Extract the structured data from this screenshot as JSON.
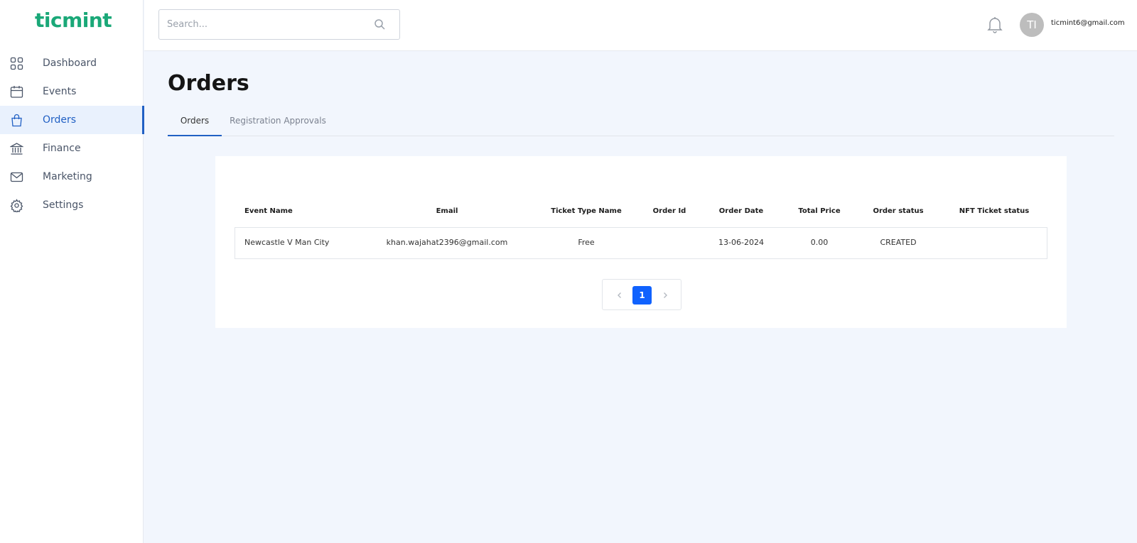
{
  "app": {
    "logo_text": "ticmint",
    "brand_color": "#1aa878",
    "accent_color": "#2160c4"
  },
  "sidebar": {
    "items": [
      {
        "label": "Dashboard",
        "icon": "grid-icon",
        "active": false
      },
      {
        "label": "Events",
        "icon": "calendar-icon",
        "active": false
      },
      {
        "label": "Orders",
        "icon": "shopping-bag-icon",
        "active": true
      },
      {
        "label": "Finance",
        "icon": "bank-icon",
        "active": false
      },
      {
        "label": "Marketing",
        "icon": "mail-icon",
        "active": false
      },
      {
        "label": "Settings",
        "icon": "gear-icon",
        "active": false
      }
    ]
  },
  "header": {
    "search_placeholder": "Search...",
    "avatar_initials": "TI",
    "user_email": "ticmint6@gmail.com"
  },
  "page": {
    "title": "Orders",
    "tabs": [
      {
        "label": "Orders",
        "active": true
      },
      {
        "label": "Registration Approvals",
        "active": false
      }
    ]
  },
  "orders_table": {
    "columns": [
      "Event Name",
      "Email",
      "Ticket Type Name",
      "Order Id",
      "Order Date",
      "Total Price",
      "Order status",
      "NFT Ticket status"
    ],
    "rows": [
      {
        "event_name": "Newcastle V Man City",
        "email": "khan.wajahat2396@gmail.com",
        "ticket_type": "Free",
        "order_id": "",
        "order_date": "13-06-2024",
        "total_price": "0.00",
        "order_status": "CREATED",
        "nft_status": ""
      }
    ]
  },
  "pagination": {
    "current_page": "1"
  }
}
